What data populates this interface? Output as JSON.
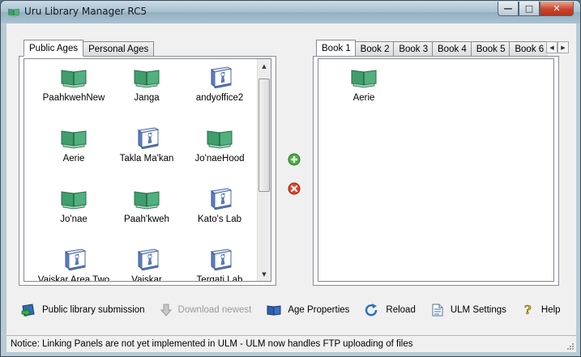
{
  "window": {
    "title": "Uru Library Manager RC5",
    "controls": {
      "minimize": "—",
      "maximize": "□",
      "close": "✕"
    }
  },
  "left_tabs": [
    {
      "label": "Public Ages",
      "active": true
    },
    {
      "label": "Personal Ages",
      "active": false
    }
  ],
  "public_ages": [
    {
      "label": "PaahkwehNew",
      "icon": "green-book-icon"
    },
    {
      "label": "Janga",
      "icon": "green-book-icon"
    },
    {
      "label": "andyoffice2",
      "icon": "blue-book-icon"
    },
    {
      "label": "Aerie",
      "icon": "green-book-icon"
    },
    {
      "label": "Takla Ma'kan",
      "icon": "blue-book-icon"
    },
    {
      "label": "Jo'naeHood",
      "icon": "green-book-icon"
    },
    {
      "label": "Jo'nae",
      "icon": "green-book-icon"
    },
    {
      "label": "Paah'kweh",
      "icon": "green-book-icon"
    },
    {
      "label": "Kato's Lab",
      "icon": "blue-book-icon"
    },
    {
      "label": "Vaiskar Area Two",
      "icon": "blue-book-icon"
    },
    {
      "label": "Vaiskar",
      "icon": "blue-book-icon"
    },
    {
      "label": "Tergati Lab",
      "icon": "blue-book-icon"
    }
  ],
  "right_tabs": [
    {
      "label": "Book 1",
      "active": true
    },
    {
      "label": "Book 2",
      "active": false
    },
    {
      "label": "Book 3",
      "active": false
    },
    {
      "label": "Book 4",
      "active": false
    },
    {
      "label": "Book 5",
      "active": false
    },
    {
      "label": "Book 6",
      "active": false
    }
  ],
  "book_ages": [
    {
      "label": "Aerie",
      "icon": "green-book-icon"
    }
  ],
  "middle": {
    "add_icon": "add-icon",
    "remove_icon": "remove-icon"
  },
  "toolbar": {
    "public_submission": "Public library submission",
    "download_newest": "Download newest",
    "age_properties": "Age Properties",
    "reload": "Reload",
    "ulm_settings": "ULM Settings",
    "help": "Help"
  },
  "status": {
    "text": "Notice: Linking Panels are not yet implemented in ULM - ULM now handles FTP uploading of files"
  },
  "colors": {
    "green_book": "#3c9a68",
    "blue_book": "#5a7fc2",
    "close_red": "#c8442b"
  }
}
